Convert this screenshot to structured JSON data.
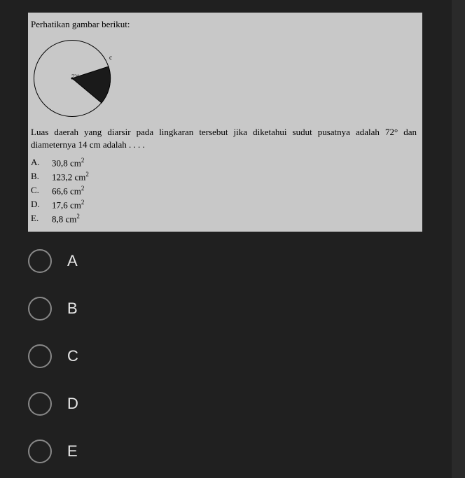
{
  "question": {
    "header": "Perhatikan gambar berikut:",
    "diagram": {
      "label_c": "c",
      "label_center": "72°"
    },
    "text": "Luas daerah yang diarsir pada lingkaran tersebut jika diketahui sudut pusatnya adalah 72° dan diameternya 14 cm adalah . . . .",
    "answers": [
      {
        "letter": "A.",
        "value": "30,8 cm",
        "unit_sup": "2"
      },
      {
        "letter": "B.",
        "value": "123,2 cm",
        "unit_sup": "2"
      },
      {
        "letter": "C.",
        "value": "66,6 cm",
        "unit_sup": "2"
      },
      {
        "letter": "D.",
        "value": "17,6 cm",
        "unit_sup": "2"
      },
      {
        "letter": "E.",
        "value": "8,8 cm",
        "unit_sup": "2"
      }
    ]
  },
  "options": [
    {
      "label": "A"
    },
    {
      "label": "B"
    },
    {
      "label": "C"
    },
    {
      "label": "D"
    },
    {
      "label": "E"
    }
  ]
}
